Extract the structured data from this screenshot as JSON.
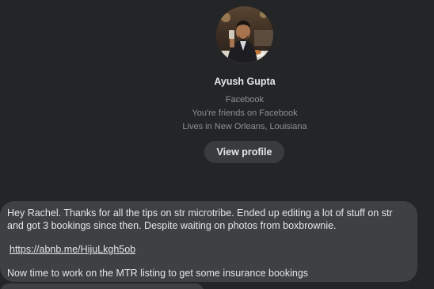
{
  "profile": {
    "name": "Ayush Gupta",
    "platform": "Facebook",
    "friendship": "You're friends on Facebook",
    "location": "Lives in New Orleans, Louisiana",
    "view_profile_label": "View profile"
  },
  "message": {
    "text": "Hey Rachel. Thanks for all the tips on str microtribe. Ended up editing  a lot of stuff on str\nand got 3 bookings since then. Despite waiting on photos from boxbrownie.",
    "link": "https://abnb.me/HijuLkgh5ob",
    "text2": "Now time to work on the MTR listing to get some insurance bookings"
  },
  "colors": {
    "background": "#242526",
    "bubble": "#3e4042",
    "button": "#3a3b3c",
    "text_primary": "#e4e6eb",
    "text_secondary": "#8e9094"
  }
}
